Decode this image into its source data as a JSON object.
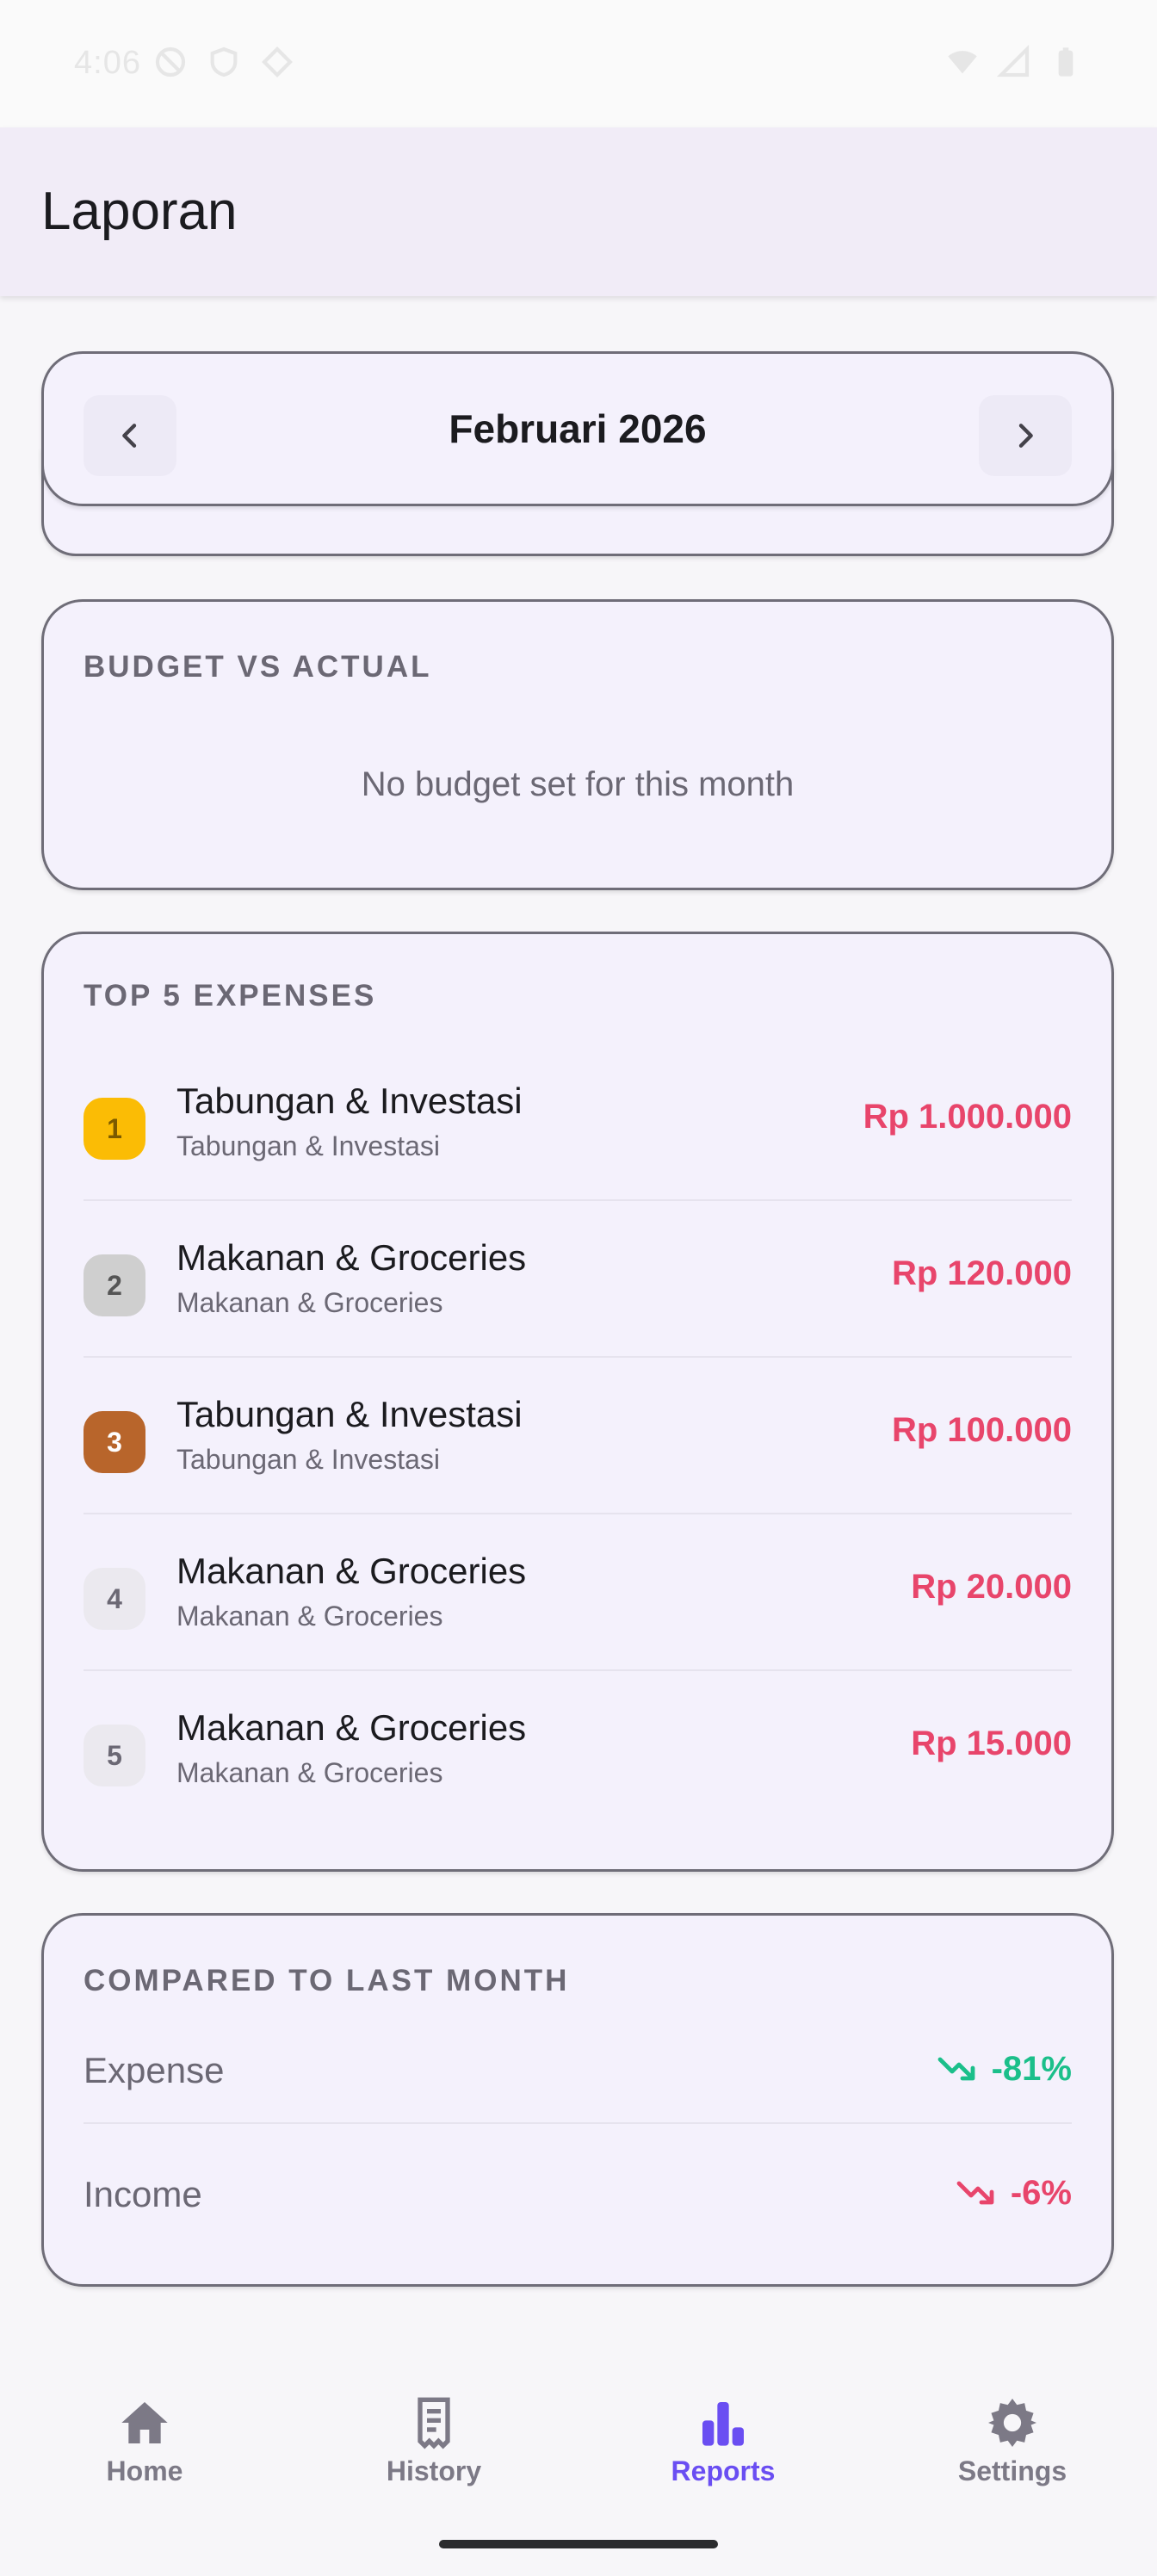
{
  "status_bar": {
    "time": "4:06"
  },
  "appbar": {
    "title": "Laporan"
  },
  "month_selector": {
    "label": "Februari 2026",
    "prev_icon": "chevron-left-icon",
    "next_icon": "chevron-right-icon"
  },
  "budget": {
    "title": "BUDGET VS ACTUAL",
    "empty_text": "No budget set for this month"
  },
  "top_expenses": {
    "title": "TOP 5 EXPENSES",
    "items": [
      {
        "rank": "1",
        "title": "Tabungan & Investasi",
        "subtitle": "Tabungan & Investasi",
        "amount": "Rp 1.000.000",
        "rank_bg": "#fbbc05",
        "rank_fg": "#7a5a00"
      },
      {
        "rank": "2",
        "title": "Makanan & Groceries",
        "subtitle": "Makanan & Groceries",
        "amount": "Rp 120.000",
        "rank_bg": "#cfcfcf",
        "rank_fg": "#555555"
      },
      {
        "rank": "3",
        "title": "Tabungan & Investasi",
        "subtitle": "Tabungan & Investasi",
        "amount": "Rp 100.000",
        "rank_bg": "#b8652b",
        "rank_fg": "#ffffff"
      },
      {
        "rank": "4",
        "title": "Makanan & Groceries",
        "subtitle": "Makanan & Groceries",
        "amount": "Rp 20.000",
        "rank_bg": "#ebe9ef",
        "rank_fg": "#6b6874"
      },
      {
        "rank": "5",
        "title": "Makanan & Groceries",
        "subtitle": "Makanan & Groceries",
        "amount": "Rp 15.000",
        "rank_bg": "#ebe9ef",
        "rank_fg": "#6b6874"
      }
    ]
  },
  "comparison": {
    "title": "COMPARED TO LAST MONTH",
    "rows": [
      {
        "label": "Expense",
        "value": "-81%",
        "color": "#1bbf8a",
        "icon": "trending-down-icon"
      },
      {
        "label": "Income",
        "value": "-6%",
        "color": "#e8456b",
        "icon": "trending-down-icon"
      }
    ]
  },
  "bottom_nav": {
    "items": [
      {
        "label": "Home",
        "icon": "home-icon"
      },
      {
        "label": "History",
        "icon": "receipt-icon"
      },
      {
        "label": "Reports",
        "icon": "bar-chart-icon",
        "active": true
      },
      {
        "label": "Settings",
        "icon": "gear-icon"
      }
    ]
  },
  "colors": {
    "accent": "#6a4ef2",
    "expense_red": "#e8456b",
    "positive_green": "#1bbf8a",
    "card_bg": "#f4f1fc"
  }
}
